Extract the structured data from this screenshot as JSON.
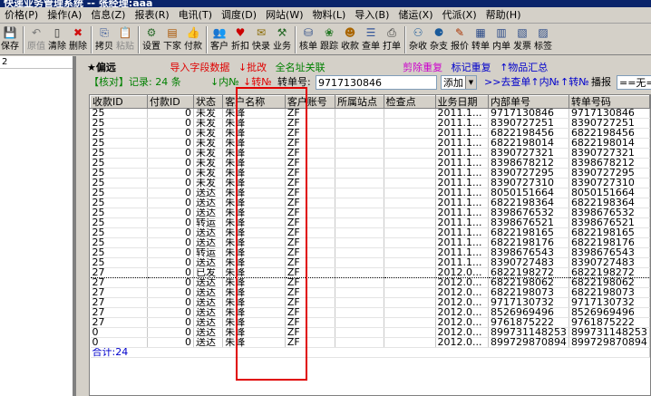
{
  "window": {
    "title": "快递业务管理系统 -- 张经理:aaa"
  },
  "menu": [
    {
      "label": "价格(P)"
    },
    {
      "label": "操作(A)"
    },
    {
      "label": "信息(Z)"
    },
    {
      "label": "报表(R)"
    },
    {
      "label": "电讯(T)"
    },
    {
      "label": "调度(D)"
    },
    {
      "label": "网站(W)"
    },
    {
      "label": "物料(L)"
    },
    {
      "label": "导入(B)"
    },
    {
      "label": "储运(X)"
    },
    {
      "label": "代派(X)"
    },
    {
      "label": "帮助(H)"
    }
  ],
  "toolbar": [
    {
      "label": "保存",
      "icon": "💾",
      "color": "#1a3f9a",
      "enabled": true
    },
    {
      "label": "原值",
      "icon": "↶",
      "color": "#7a7a7a",
      "enabled": false
    },
    {
      "label": "清除",
      "icon": "▯",
      "color": "#333333",
      "enabled": true
    },
    {
      "label": "删除",
      "icon": "✖",
      "color": "#d01010",
      "enabled": true
    },
    {
      "label": "拷贝",
      "icon": "⎘",
      "color": "#335599",
      "enabled": true
    },
    {
      "label": "粘贴",
      "icon": "📋",
      "color": "#7a7a7a",
      "enabled": false
    },
    {
      "label": "设置",
      "icon": "⚙",
      "color": "#2a6a2a",
      "enabled": true
    },
    {
      "label": "下家",
      "icon": "▤",
      "color": "#aa5500",
      "enabled": true
    },
    {
      "label": "付款",
      "icon": "👍",
      "color": "#cc7700",
      "enabled": true
    },
    {
      "label": "客户",
      "icon": "👥",
      "color": "#335599",
      "enabled": true
    },
    {
      "label": "折扣",
      "icon": "♥",
      "color": "#cc0000",
      "enabled": true
    },
    {
      "label": "快录",
      "icon": "✉",
      "color": "#8a6a00",
      "enabled": true
    },
    {
      "label": "业务",
      "icon": "⚒",
      "color": "#226622",
      "enabled": true
    },
    {
      "label": "核单",
      "icon": "⛁",
      "color": "#2a4a88",
      "enabled": true
    },
    {
      "label": "跟踪",
      "icon": "❀",
      "color": "#227722",
      "enabled": true
    },
    {
      "label": "收款",
      "icon": "☻",
      "color": "#aa6600",
      "enabled": true
    },
    {
      "label": "查单",
      "icon": "☰",
      "color": "#335599",
      "enabled": true
    },
    {
      "label": "打单",
      "icon": "⎙",
      "color": "#333333",
      "enabled": true
    },
    {
      "label": "杂收",
      "icon": "⚇",
      "color": "#1a5a9a",
      "enabled": true
    },
    {
      "label": "杂支",
      "icon": "⚈",
      "color": "#1a5a9a",
      "enabled": true
    },
    {
      "label": "报价",
      "icon": "✎",
      "color": "#aa3300",
      "enabled": true
    },
    {
      "label": "转单",
      "icon": "▦",
      "color": "#2a4a88",
      "enabled": true
    },
    {
      "label": "内单",
      "icon": "▥",
      "color": "#2a4a88",
      "enabled": true
    },
    {
      "label": "发票",
      "icon": "▧",
      "color": "#2a4a88",
      "enabled": true
    },
    {
      "label": "标签",
      "icon": "▨",
      "color": "#2a4a88",
      "enabled": true
    }
  ],
  "left": {
    "header": "2"
  },
  "info": {
    "title": "★偏远",
    "import": "导入字段数据",
    "batch": "↓批改",
    "fullname": "全名址关联",
    "cut_dup": "剪除重复",
    "mark_dup": "标记重复",
    "goods": "↑物品汇总"
  },
  "filter": {
    "mode": "【核对】",
    "record_label": "记录:",
    "record_count": "24",
    "unit": "条",
    "inner_no": "↓内№",
    "trans_no": "↓转№",
    "trans_label": "转单号:",
    "trans_value": "9717130846",
    "combo_value": "添加",
    "query_inner": ">>去查单↑内№",
    "trans2": "↑转№",
    "sort_label": "播报",
    "sort_value": "==无=="
  },
  "table": {
    "headers": [
      "收款ID",
      "付款ID",
      "状态",
      "客户名称",
      "客户账号",
      "所属站点",
      "检查点",
      "业务日期",
      "内部单号",
      "转单号码"
    ],
    "rows": [
      [
        "25",
        "0",
        "未发",
        "朱峰",
        "ZF",
        "",
        "",
        "2011.1...",
        "9717130846",
        "9717130846"
      ],
      [
        "25",
        "0",
        "未发",
        "朱峰",
        "ZF",
        "",
        "",
        "2011.1...",
        "8390727251",
        "8390727251"
      ],
      [
        "25",
        "0",
        "未发",
        "朱峰",
        "ZF",
        "",
        "",
        "2011.1...",
        "6822198456",
        "6822198456"
      ],
      [
        "25",
        "0",
        "未发",
        "朱峰",
        "ZF",
        "",
        "",
        "2011.1...",
        "6822198014",
        "6822198014"
      ],
      [
        "25",
        "0",
        "未发",
        "朱峰",
        "ZF",
        "",
        "",
        "2011.1...",
        "8390727321",
        "8390727321"
      ],
      [
        "25",
        "0",
        "未发",
        "朱峰",
        "ZF",
        "",
        "",
        "2011.1...",
        "8398678212",
        "8398678212"
      ],
      [
        "25",
        "0",
        "未发",
        "朱峰",
        "ZF",
        "",
        "",
        "2011.1...",
        "8390727295",
        "8390727295"
      ],
      [
        "25",
        "0",
        "未发",
        "朱峰",
        "ZF",
        "",
        "",
        "2011.1...",
        "8390727310",
        "8390727310"
      ],
      [
        "25",
        "0",
        "送达",
        "朱峰",
        "ZF",
        "",
        "",
        "2011.1...",
        "8050151664",
        "8050151664"
      ],
      [
        "25",
        "0",
        "送达",
        "朱峰",
        "ZF",
        "",
        "",
        "2011.1...",
        "6822198364",
        "6822198364"
      ],
      [
        "25",
        "0",
        "送达",
        "朱峰",
        "ZF",
        "",
        "",
        "2011.1...",
        "8398676532",
        "8398676532"
      ],
      [
        "25",
        "0",
        "转运",
        "朱峰",
        "ZF",
        "",
        "",
        "2011.1...",
        "8398676521",
        "8398676521"
      ],
      [
        "25",
        "0",
        "送达",
        "朱峰",
        "ZF",
        "",
        "",
        "2011.1...",
        "6822198165",
        "6822198165"
      ],
      [
        "25",
        "0",
        "送达",
        "朱峰",
        "ZF",
        "",
        "",
        "2011.1...",
        "6822198176",
        "6822198176"
      ],
      [
        "25",
        "0",
        "转运",
        "朱峰",
        "ZF",
        "",
        "",
        "2011.1...",
        "8398676543",
        "8398676543"
      ],
      [
        "25",
        "0",
        "送达",
        "朱峰",
        "ZF",
        "",
        "",
        "2011.1...",
        "8390727483",
        "8390727483"
      ],
      [
        "27",
        "0",
        "已发",
        "朱峰",
        "ZF",
        "",
        "",
        "2012.0...",
        "6822198272",
        "6822198272"
      ],
      [
        "27",
        "0",
        "送达",
        "朱峰",
        "ZF",
        "",
        "",
        "2012.0...",
        "6822198062",
        "6822198062"
      ],
      [
        "27",
        "0",
        "送达",
        "朱峰",
        "ZF",
        "",
        "",
        "2012.0...",
        "6822198073",
        "6822198073"
      ],
      [
        "27",
        "0",
        "送达",
        "朱峰",
        "ZF",
        "",
        "",
        "2012.0...",
        "9717130732",
        "9717130732"
      ],
      [
        "27",
        "0",
        "送达",
        "朱峰",
        "ZF",
        "",
        "",
        "2012.0...",
        "8526969496",
        "8526969496"
      ],
      [
        "27",
        "0",
        "送达",
        "朱峰",
        "ZF",
        "",
        "",
        "2012.0...",
        "9761875222",
        "9761875222"
      ],
      [
        "0",
        "0",
        "送达",
        "朱峰",
        "ZF",
        "",
        "",
        "2012.0...",
        "899731148253",
        "899731148253"
      ],
      [
        "0",
        "0",
        "送达",
        "朱峰",
        "ZF",
        "",
        "",
        "2012.0...",
        "899729870894",
        "899729870894"
      ]
    ],
    "total": "合计:24"
  },
  "colors": {
    "title_bar": "#0a246a",
    "import_red": "#e00000",
    "fullname_green": "#008000",
    "purple": "#cc00cc",
    "blue": "#0000cc",
    "green_text": "#008000",
    "highlight_box": "#e00000"
  }
}
